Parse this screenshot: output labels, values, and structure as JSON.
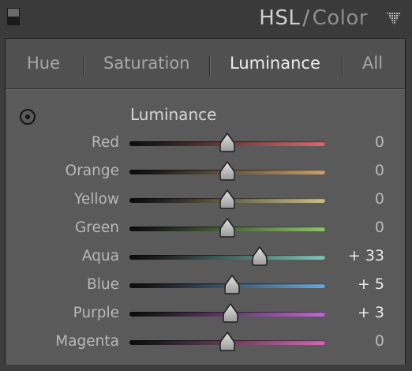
{
  "header": {
    "title_main": "HSL",
    "title_sep": "/",
    "title_secondary": "Color"
  },
  "tabs": [
    {
      "label": "Hue",
      "active": false
    },
    {
      "label": "Saturation",
      "active": false
    },
    {
      "label": "Luminance",
      "active": true
    },
    {
      "label": "All",
      "active": false
    }
  ],
  "section": {
    "title": "Luminance"
  },
  "slider_range": [
    -100,
    100
  ],
  "sliders": [
    {
      "label": "Red",
      "value": 0,
      "display": "0",
      "color": "#d86a6a"
    },
    {
      "label": "Orange",
      "value": 0,
      "display": "0",
      "color": "#c9a070"
    },
    {
      "label": "Yellow",
      "value": 0,
      "display": "0",
      "color": "#c9c08a"
    },
    {
      "label": "Green",
      "value": 0,
      "display": "0",
      "color": "#8fc46a"
    },
    {
      "label": "Aqua",
      "value": 33,
      "display": "+ 33",
      "color": "#7cc8b8"
    },
    {
      "label": "Blue",
      "value": 5,
      "display": "+ 5",
      "color": "#6aa6d8"
    },
    {
      "label": "Purple",
      "value": 3,
      "display": "+ 3",
      "color": "#c06ad2"
    },
    {
      "label": "Magenta",
      "value": 0,
      "display": "0",
      "color": "#d06ab0"
    }
  ],
  "icons": {
    "panel_toggle": "panel-toggle-icon",
    "collapse": "collapse-triangle-icon",
    "targeted_adjustment": "target-adjustment-icon"
  }
}
